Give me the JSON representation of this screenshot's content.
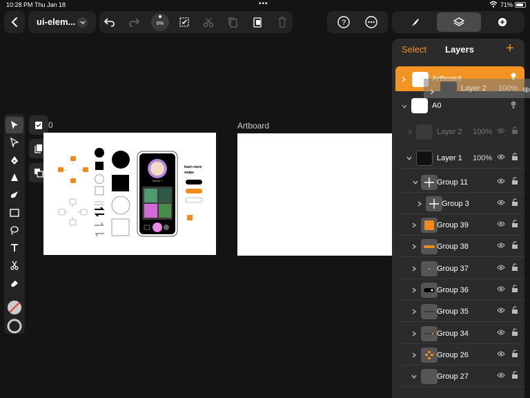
{
  "status": {
    "time": "10:28 PM",
    "date": "Thu Jan 18",
    "battery": "71%"
  },
  "toolbar": {
    "doc_title": "ui-elem...",
    "zoom": "6%"
  },
  "panel": {
    "select": "Select",
    "title": "Layers",
    "rows": [
      {
        "name": "Artboard",
        "drag_name": "Layer 2",
        "drag_opacity": "100%"
      },
      {
        "name": "A0"
      },
      {
        "name": "Layer 2",
        "opacity": "100%"
      },
      {
        "name": "Layer 1",
        "opacity": "100%"
      },
      {
        "name": "Group 11"
      },
      {
        "name": "Group 3"
      },
      {
        "name": "Group 39"
      },
      {
        "name": "Group 38"
      },
      {
        "name": "Group 37"
      },
      {
        "name": "Group 36"
      },
      {
        "name": "Group 35"
      },
      {
        "name": "Group 34"
      },
      {
        "name": "Group 26"
      },
      {
        "name": "Group 27"
      }
    ]
  },
  "canvas": {
    "artboard1_label": "0",
    "artboard2_label": "Artboard",
    "phone": {
      "name": "Alexia T.",
      "learn": "learn more",
      "swipe": "swipe"
    }
  },
  "colors": {
    "accent": "#f39323",
    "panel": "#2b2b2b",
    "toolbar": "#232323",
    "background": "#141414"
  }
}
